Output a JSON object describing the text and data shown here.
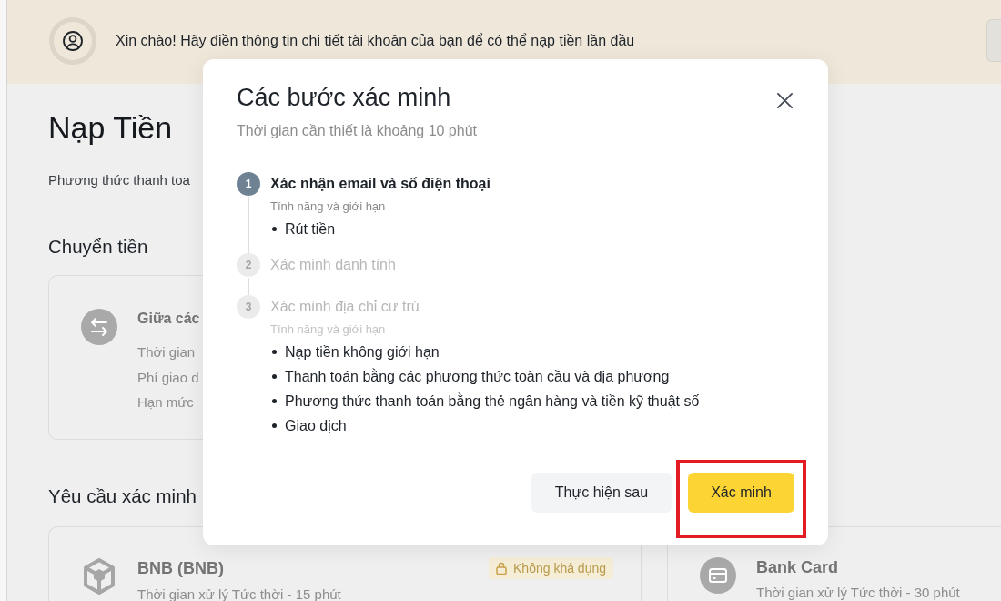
{
  "banner": {
    "message": "Xin chào! Hãy điền thông tin chi tiết tài khoản của bạn để có thể nạp tiền lần đầu"
  },
  "page": {
    "title": "Nạp Tiền",
    "subtitle": "Phương thức thanh toa"
  },
  "sections": [
    {
      "heading": "Chuyển tiền",
      "cards": [
        {
          "kind": "transfer",
          "title": "Giữa các",
          "lines": [
            "Thời gian",
            "Phí giao d",
            "Hạn mức"
          ]
        }
      ]
    },
    {
      "heading": "Yêu cầu xác minh",
      "cards": [
        {
          "kind": "crypto",
          "title": "BNB (BNB)",
          "badge": "Không khả dụng",
          "lines": [
            "Thời gian xử lý Tức thời - 15 phút"
          ]
        },
        {
          "kind": "bank_card",
          "title": "Bank Card",
          "lines": [
            "Thời gian xử lý Tức thời - 30 phút"
          ]
        }
      ]
    }
  ],
  "modal": {
    "title": "Các bước xác minh",
    "subtitle": "Thời gian cần thiết là khoảng 10 phút",
    "steps": [
      {
        "number": "1",
        "title": "Xác nhận email và số điện thoại",
        "active": true,
        "features_label": "Tính năng và giới hạn",
        "features": [
          "Rút tiền"
        ]
      },
      {
        "number": "2",
        "title": "Xác minh danh tính",
        "active": false
      },
      {
        "number": "3",
        "title": "Xác minh địa chỉ cư trú",
        "active": false,
        "features_label": "Tính năng và giới hạn",
        "features": [
          "Nạp tiền không giới hạn",
          "Thanh toán bằng các phương thức toàn cầu và địa phương",
          "Phương thức thanh toán bằng thẻ ngân hàng và tiền kỹ thuật số",
          "Giao dịch"
        ]
      }
    ],
    "buttons": [
      {
        "label": "Thực hiện sau",
        "kind": "secondary",
        "highlighted": false
      },
      {
        "label": "Xác minh",
        "kind": "primary",
        "highlighted": true
      }
    ]
  }
}
